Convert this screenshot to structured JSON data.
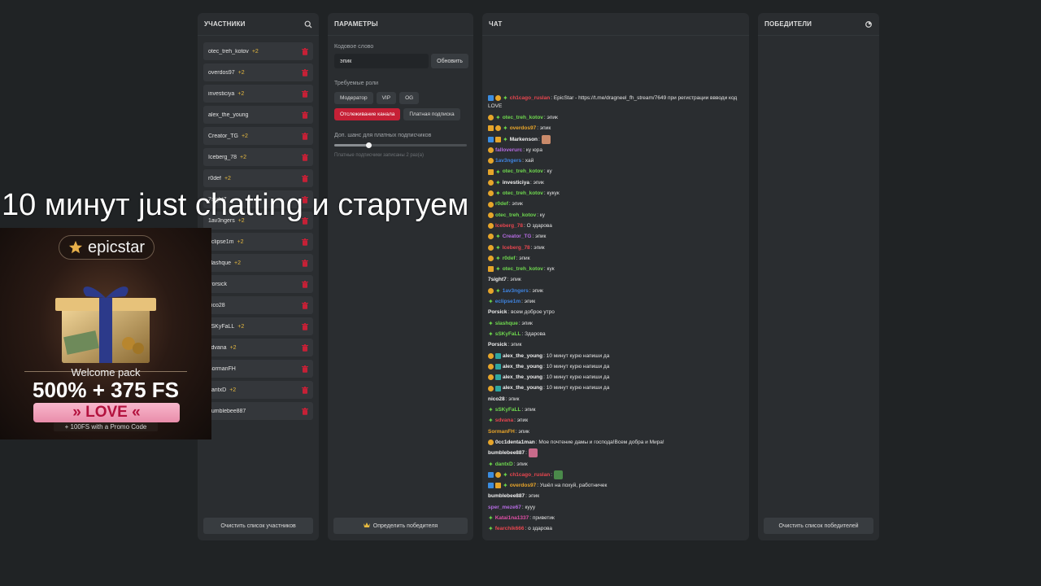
{
  "participants": {
    "title": "УЧАСТНИКИ",
    "items": [
      {
        "name": "otec_treh_kotov",
        "bonus": "+2"
      },
      {
        "name": "overdos97",
        "bonus": "+2"
      },
      {
        "name": "investiciya",
        "bonus": "+2"
      },
      {
        "name": "alex_the_young",
        "bonus": ""
      },
      {
        "name": "Creator_TG",
        "bonus": "+2"
      },
      {
        "name": "Iceberg_78",
        "bonus": "+2"
      },
      {
        "name": "r0def",
        "bonus": "+2"
      },
      {
        "name": "7sight7",
        "bonus": ""
      },
      {
        "name": "1av3ngers",
        "bonus": "+2"
      },
      {
        "name": "eclipse1m",
        "bonus": "+2"
      },
      {
        "name": "slashque",
        "bonus": "+2"
      },
      {
        "name": "Porsick",
        "bonus": ""
      },
      {
        "name": "nico28",
        "bonus": ""
      },
      {
        "name": "sSKyFaLL",
        "bonus": "+2"
      },
      {
        "name": "sdvana",
        "bonus": "+2"
      },
      {
        "name": "SormanFH",
        "bonus": ""
      },
      {
        "name": "dantxD",
        "bonus": "+2"
      },
      {
        "name": "bumblebee887",
        "bonus": ""
      }
    ],
    "footer_button": "Очистить список участников"
  },
  "params": {
    "title": "ПАРАМЕТРЫ",
    "keyword_label": "Кодовое слово",
    "keyword_value": "эпик",
    "update_button": "Обновить",
    "roles_label": "Требуемые роли",
    "roles_row1": [
      "Модератор",
      "VIP",
      "OG"
    ],
    "roles_row2": [
      {
        "label": "Отслеживание канала",
        "active": true
      },
      {
        "label": "Платная подписка",
        "active": false
      }
    ],
    "chance_label": "Доп. шанс для платных подписчиков",
    "chance_value": 0.26,
    "chance_note": "Платные подписчики записаны 2 раз(а)",
    "footer_button": "Определить победителя"
  },
  "chat": {
    "title": "ЧАТ",
    "messages": [
      {
        "badges": [
          "mod",
          "sub",
          "star"
        ],
        "nick": "ch1cago_ruslan",
        "color": "#e8464f",
        "text": ": EpicStar - https://t.me/dragneel_fh_stream/7649 при регистрации ввводи код LOVE",
        "wrap": true
      },
      {
        "badges": [
          "sub",
          "star"
        ],
        "nick": "otec_treh_kotov",
        "color": "#6fd84f",
        "text": ": эпик"
      },
      {
        "badges": [
          "vip",
          "sub",
          "star"
        ],
        "nick": "overdos97",
        "color": "#e8a52a",
        "text": ": эпик"
      },
      {
        "badges": [
          "mod",
          "vip",
          "star"
        ],
        "nick": "Markenson",
        "color": "#f0f0f0",
        "text": ":",
        "emote": "#c98a6a"
      },
      {
        "badges": [
          "sub"
        ],
        "nick": "falloverurc",
        "color": "#b46be0",
        "text": ": ку юра"
      },
      {
        "badges": [
          "sub"
        ],
        "nick": "1av3ngers",
        "color": "#3f84e0",
        "text": ": хай"
      },
      {
        "badges": [
          "vip",
          "star"
        ],
        "nick": "otec_treh_kotov",
        "color": "#6fd84f",
        "text": ": ку"
      },
      {
        "badges": [
          "sub",
          "star"
        ],
        "nick": "investiciya",
        "color": "#f0f0f0",
        "text": ": эпик"
      },
      {
        "badges": [
          "sub",
          "star"
        ],
        "nick": "otec_treh_kotov",
        "color": "#6fd84f",
        "text": ": кукук"
      },
      {
        "badges": [
          "sub"
        ],
        "nick": "r0def",
        "color": "#6fd84f",
        "text": ": эпик"
      },
      {
        "badges": [
          "sub"
        ],
        "nick": "otec_treh_kotov",
        "color": "#6fd84f",
        "text": ": ку"
      },
      {
        "badges": [
          "sub"
        ],
        "nick": "Iceberg_78",
        "color": "#e8464f",
        "text": ": О здарова"
      },
      {
        "badges": [
          "sub",
          "star"
        ],
        "nick": "Creator_TG",
        "color": "#b46be0",
        "text": ": эпик"
      },
      {
        "badges": [
          "sub",
          "star"
        ],
        "nick": "Iceberg_78",
        "color": "#e8464f",
        "text": ": эпик"
      },
      {
        "badges": [
          "sub",
          "star"
        ],
        "nick": "r0def",
        "color": "#6fd84f",
        "text": ": эпик"
      },
      {
        "badges": [
          "vip",
          "star"
        ],
        "nick": "otec_treh_kotov",
        "color": "#6fd84f",
        "text": ": кук"
      },
      {
        "badges": [],
        "nick": "7sight7",
        "color": "#f0f0f0",
        "text": ": эпик"
      },
      {
        "badges": [
          "sub",
          "star"
        ],
        "nick": "1av3ngers",
        "color": "#3f84e0",
        "text": ": эпик"
      },
      {
        "badges": [
          "star"
        ],
        "nick": "eclipse1m",
        "color": "#3f84e0",
        "text": ": эпик"
      },
      {
        "badges": [],
        "nick": "Porsick",
        "color": "#f0f0f0",
        "text": ": всем доброе утро"
      },
      {
        "badges": [
          "star"
        ],
        "nick": "slashque",
        "color": "#6fd84f",
        "text": ": эпик"
      },
      {
        "badges": [
          "star"
        ],
        "nick": "sSKyFaLL",
        "color": "#6fd84f",
        "text": ": Здарова"
      },
      {
        "badges": [],
        "nick": "Porsick",
        "color": "#f0f0f0",
        "text": ": эпик"
      },
      {
        "badges": [
          "sub",
          "gift"
        ],
        "nick": "alex_the_young",
        "color": "#f0f0f0",
        "text": ": 10 минут курю напиши да"
      },
      {
        "badges": [
          "sub",
          "gift"
        ],
        "nick": "alex_the_young",
        "color": "#f0f0f0",
        "text": ": 10 минут курю напиши да"
      },
      {
        "badges": [
          "sub",
          "gift"
        ],
        "nick": "alex_the_young",
        "color": "#f0f0f0",
        "text": ": 10 минут курю напиши да"
      },
      {
        "badges": [
          "sub",
          "gift"
        ],
        "nick": "alex_the_young",
        "color": "#f0f0f0",
        "text": ": 10 минут курю напиши да"
      },
      {
        "badges": [],
        "nick": "nico28",
        "color": "#f0f0f0",
        "text": ": эпик"
      },
      {
        "badges": [
          "star"
        ],
        "nick": "sSKyFaLL",
        "color": "#6fd84f",
        "text": ": эпик"
      },
      {
        "badges": [
          "star"
        ],
        "nick": "sdvana",
        "color": "#e8464f",
        "text": ": эпик"
      },
      {
        "badges": [],
        "nick": "SormanFH",
        "color": "#e8a52a",
        "text": ": эпик"
      },
      {
        "badges": [
          "sub"
        ],
        "nick": "0cc1denta1man",
        "color": "#f0f0f0",
        "text": ": Мое почтение дамы и господа!Всем добра и Мира!"
      },
      {
        "badges": [],
        "nick": "bumblebee887",
        "color": "#f0f0f0",
        "text": ":",
        "emote": "#c86a8a"
      },
      {
        "badges": [
          "star"
        ],
        "nick": "dantxD",
        "color": "#6fd84f",
        "text": ": эпик"
      },
      {
        "badges": [
          "mod",
          "sub",
          "star"
        ],
        "nick": "ch1cago_ruslan",
        "color": "#e8464f",
        "text": ":",
        "emote": "#4a8a4a"
      },
      {
        "badges": [
          "mod",
          "vip",
          "star"
        ],
        "nick": "overdos97",
        "color": "#e8a52a",
        "text": ": Ушёл на похуй, работничек"
      },
      {
        "badges": [],
        "nick": "bumblebee887",
        "color": "#f0f0f0",
        "text": ": эпик"
      },
      {
        "badges": [],
        "nick": "sper_meze67",
        "color": "#b46be0",
        "text": ": кууу"
      },
      {
        "badges": [
          "star"
        ],
        "nick": "Katai1na1337",
        "color": "#e04fa6",
        "text": ": приветик"
      },
      {
        "badges": [
          "star"
        ],
        "nick": "fearchik666",
        "color": "#e8464f",
        "text": ": о здарова"
      }
    ]
  },
  "winners": {
    "title": "ПОБЕДИТЕЛИ",
    "footer_button": "Очистить список победителей"
  },
  "overlay": {
    "caption": "10 минут just chatting и стартуем",
    "promo": {
      "brand": "epicstar",
      "welcome": "Welcome pack",
      "offer": "500% + 375 FS",
      "code": "» LOVE «",
      "small": "+ 100FS with a Promo Code"
    }
  },
  "colors": {
    "accent_red": "#c62036",
    "panel_bg": "#2a2d30",
    "page_bg": "#202325"
  }
}
